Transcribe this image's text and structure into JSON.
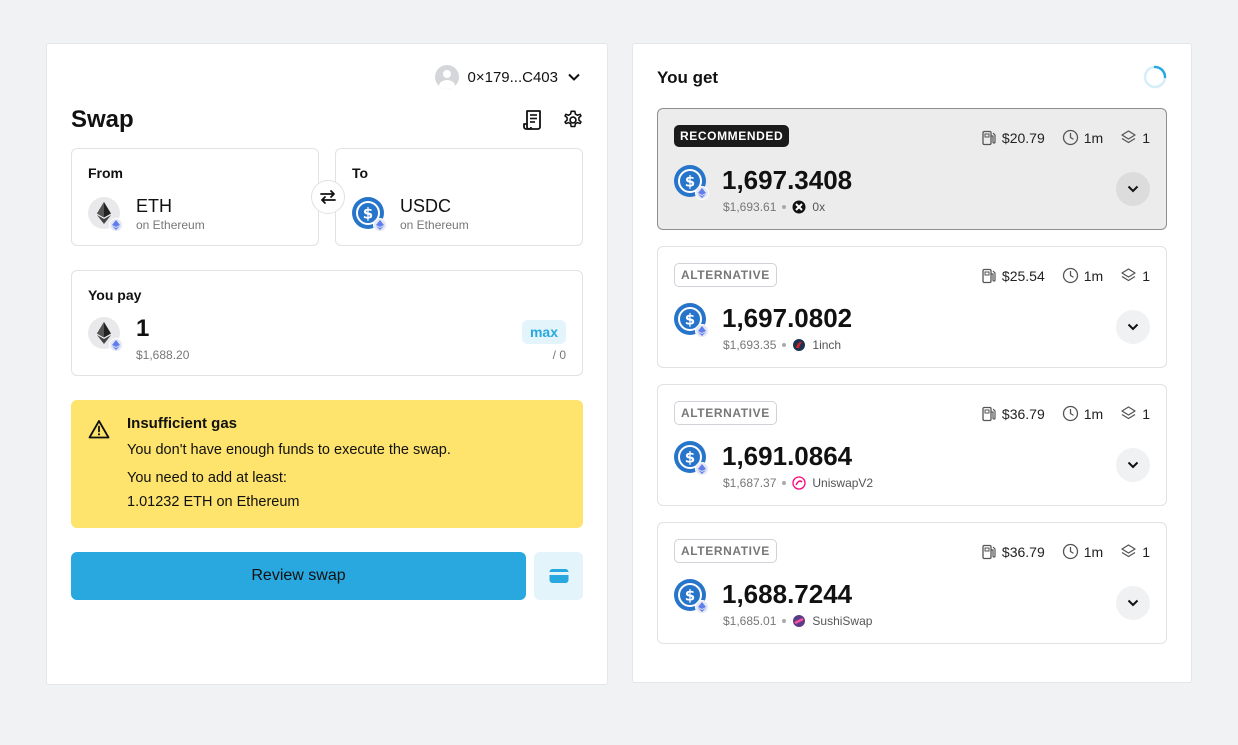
{
  "wallet": {
    "address": "0×179...C403",
    "icon": "user-avatar-icon"
  },
  "swap": {
    "title": "Swap",
    "from": {
      "label": "From",
      "symbol": "ETH",
      "network": "on Ethereum",
      "icon": "eth-icon"
    },
    "to": {
      "label": "To",
      "symbol": "USDC",
      "network": "on Ethereum",
      "icon": "usdc-icon"
    },
    "pay": {
      "label": "You pay",
      "amount": "1",
      "usd": "$1,688.20",
      "max_label": "max",
      "balance": "/ 0"
    },
    "warning": {
      "title": "Insufficient gas",
      "line1": "You don't have enough funds to execute the swap.",
      "line2": "You need to add at least:",
      "line3": "1.01232 ETH on Ethereum"
    },
    "review_label": "Review swap"
  },
  "you_get": {
    "title": "You get",
    "routes": [
      {
        "badge": "RECOMMENDED",
        "gas": "$20.79",
        "time": "1m",
        "steps": "1",
        "amount": "1,697.3408",
        "usd": "$1,693.61",
        "dex": "0x",
        "recommended": true
      },
      {
        "badge": "ALTERNATIVE",
        "gas": "$25.54",
        "time": "1m",
        "steps": "1",
        "amount": "1,697.0802",
        "usd": "$1,693.35",
        "dex": "1inch",
        "recommended": false
      },
      {
        "badge": "ALTERNATIVE",
        "gas": "$36.79",
        "time": "1m",
        "steps": "1",
        "amount": "1,691.0864",
        "usd": "$1,687.37",
        "dex": "UniswapV2",
        "recommended": false
      },
      {
        "badge": "ALTERNATIVE",
        "gas": "$36.79",
        "time": "1m",
        "steps": "1",
        "amount": "1,688.7244",
        "usd": "$1,685.01",
        "dex": "SushiSwap",
        "recommended": false
      }
    ]
  },
  "colors": {
    "accent": "#29a8e0",
    "warning_bg": "#fee46c",
    "usdc": "#2775ca"
  }
}
